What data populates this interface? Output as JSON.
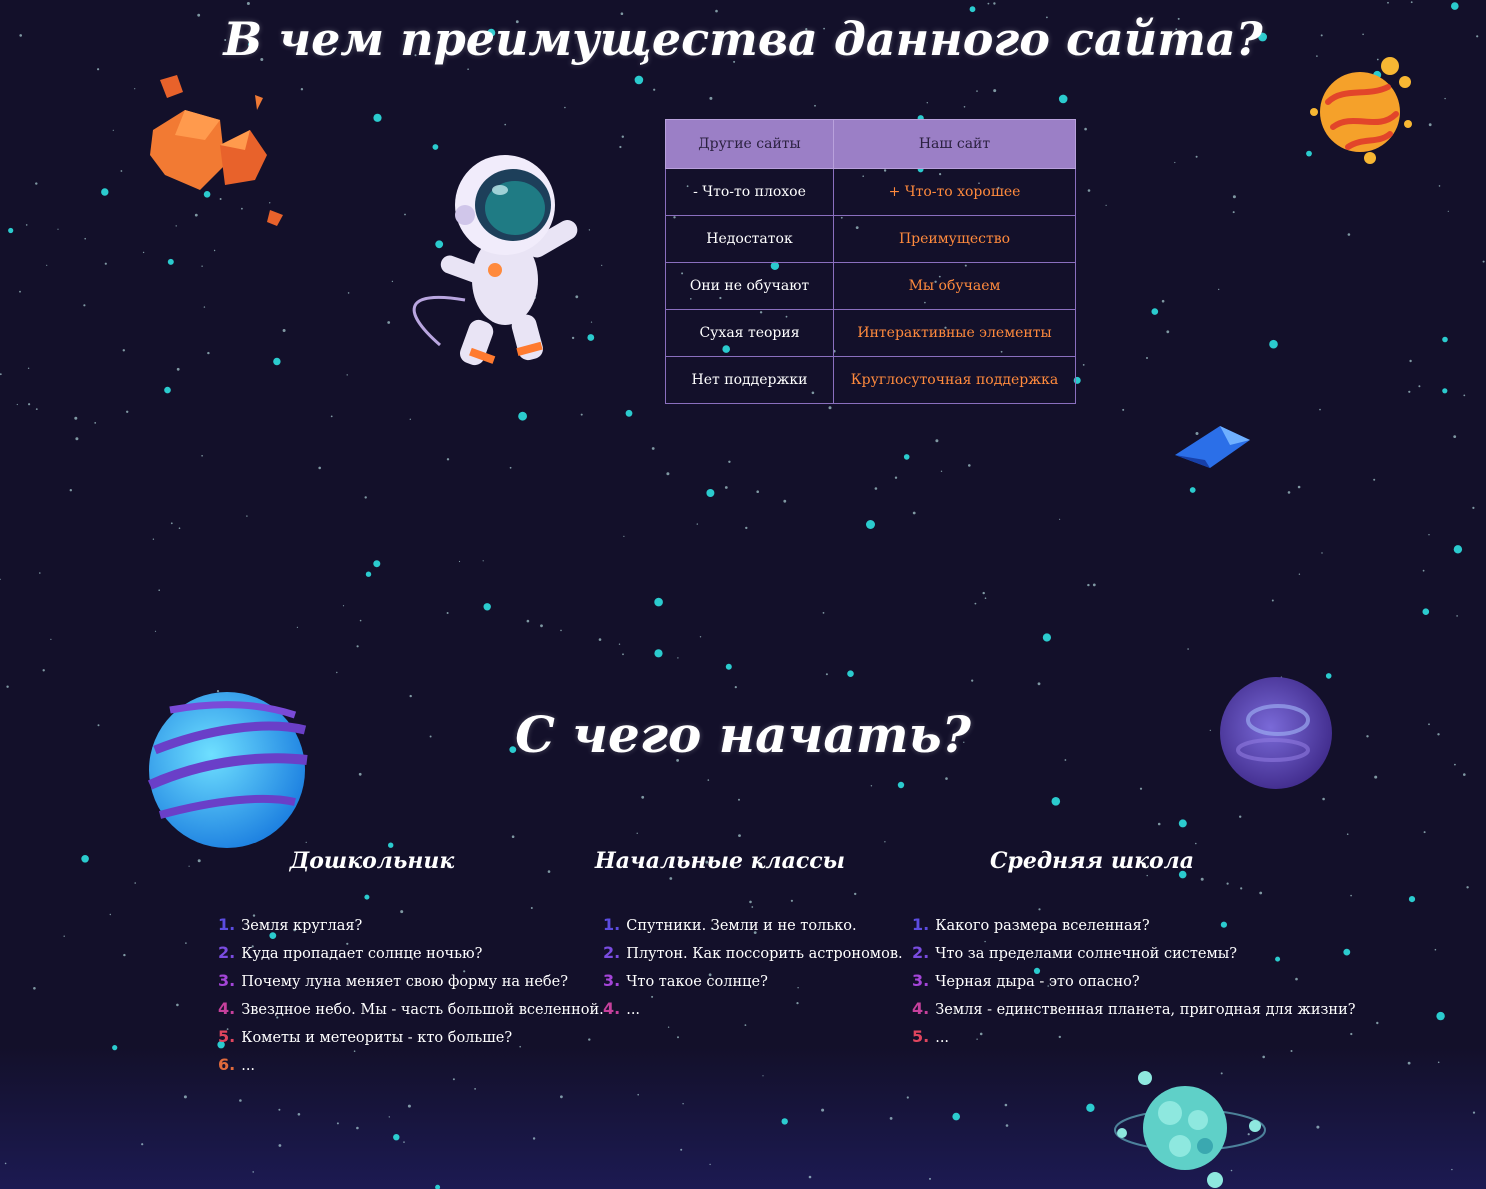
{
  "headings": {
    "main_title": "В чем преимущества данного сайта?",
    "section_title": "С чего начать?"
  },
  "comparison": {
    "headers": [
      "Другие сайты",
      "Наш сайт"
    ],
    "rows": [
      {
        "other": "- Что-то плохое",
        "ours": "+ Что-то хорошее"
      },
      {
        "other": "Недостаток",
        "ours": "Преимущество"
      },
      {
        "other": "Они не обучают",
        "ours": "Мы обучаем"
      },
      {
        "other": "Сухая теория",
        "ours": "Интерактивные элементы"
      },
      {
        "other": "Нет поддержки",
        "ours": "Круглосуточная поддержка"
      }
    ]
  },
  "columns": [
    {
      "title": "Дошкольник",
      "items": [
        "Земля круглая?",
        "Куда пропадает солнце ночью?",
        "Почему луна меняет свою форму на небе?",
        "Звездное небо. Мы - часть большой вселенной.",
        "Кометы и метеориты - кто больше?",
        "..."
      ]
    },
    {
      "title": "Начальные классы",
      "items": [
        "Спутники. Земли и не только.",
        "Плутон. Как поссорить астрономов.",
        "Что такое солнце?",
        "..."
      ]
    },
    {
      "title": "Средняя школа",
      "items": [
        "Какого размера вселенная?",
        "Что за пределами солнечной системы?",
        "Черная дыра - это опасно?",
        "Земля - единственная планета, пригодная для жизни?",
        "..."
      ]
    }
  ],
  "colors": {
    "background": "#13102a",
    "table_header": "#9b7fc6",
    "accent_orange": "#ff8a3d",
    "star": "#2fe0e0"
  },
  "decorations": [
    "orange-asteroid-icon",
    "astronaut-icon",
    "lava-planet-icon",
    "blue-crystal-icon",
    "striped-blue-planet-icon",
    "purple-planet-icon",
    "teal-planet-with-moons-icon"
  ]
}
